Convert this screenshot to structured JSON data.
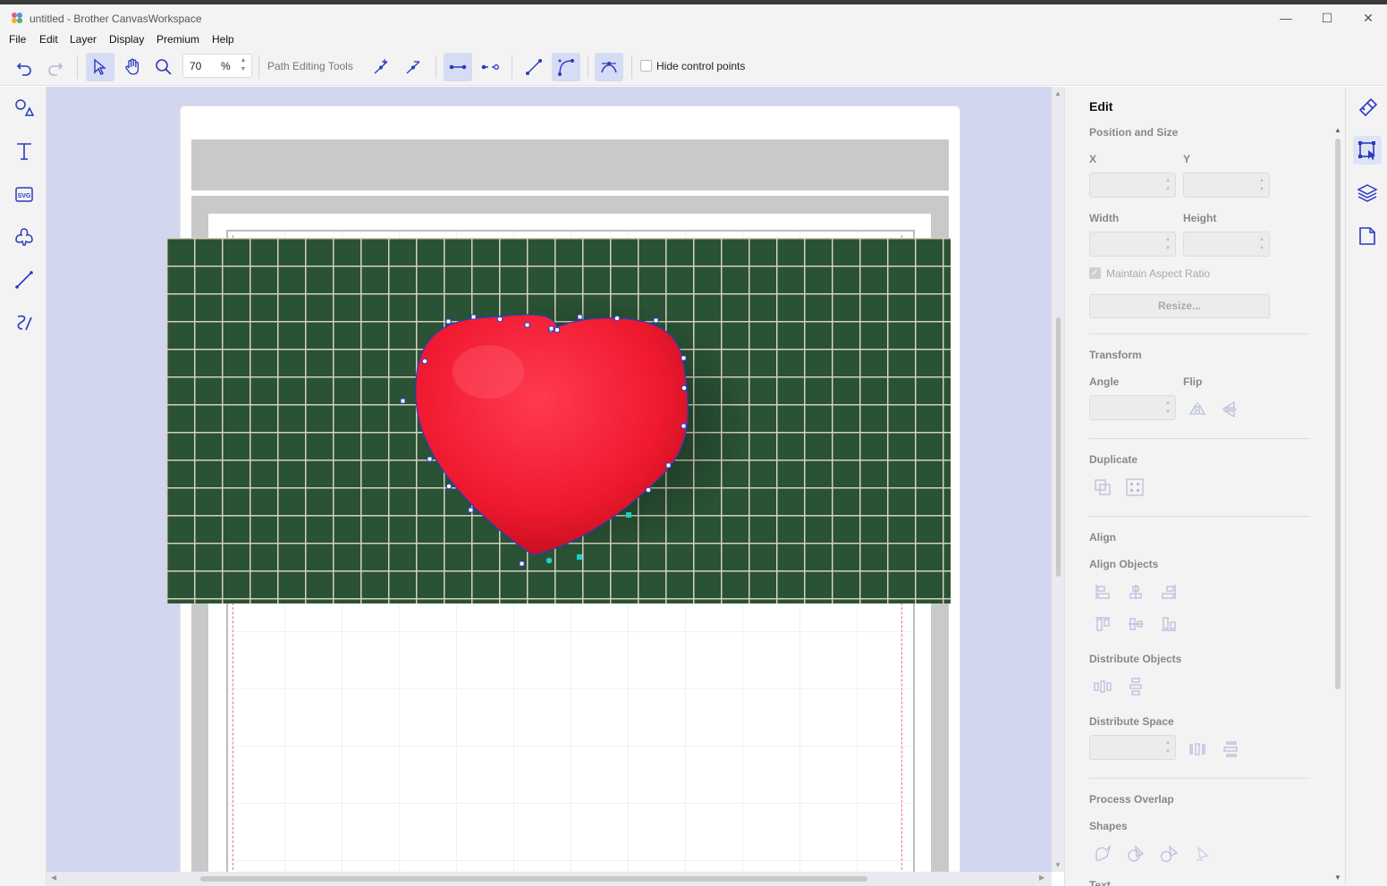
{
  "window": {
    "title": "untitled - Brother CanvasWorkspace",
    "minimize_glyph": "—",
    "maximize_glyph": "☐",
    "close_glyph": "✕"
  },
  "menu": {
    "items": [
      "File",
      "Edit",
      "Layer",
      "Display",
      "Premium",
      "Help"
    ]
  },
  "toolbar": {
    "zoom_value": "70",
    "zoom_unit": "%",
    "path_editing_label": "Path Editing Tools",
    "hide_control_points_label": "Hide control points",
    "hide_control_points_checked": false
  },
  "icons": {
    "toolbar": [
      "undo-icon",
      "redo-icon",
      "select-icon",
      "pan-hand-icon",
      "zoom-icon",
      "add-node-icon",
      "delete-node-icon",
      "join-nodes-icon",
      "break-node-icon",
      "straight-segment-icon",
      "curve-segment-icon",
      "smooth-node-icon"
    ],
    "left_tools": [
      "shapes-icon",
      "text-icon",
      "svg-icon",
      "pattern-icon",
      "line-icon",
      "freehand-icon"
    ],
    "right_tabs": [
      "paint-icon",
      "edit-transform-icon",
      "layers-icon",
      "page-icon"
    ]
  },
  "panel": {
    "title": "Edit",
    "position_size": "Position and Size",
    "x_label": "X",
    "y_label": "Y",
    "width_label": "Width",
    "height_label": "Height",
    "maintain_aspect": "Maintain Aspect Ratio",
    "resize_button": "Resize...",
    "transform": "Transform",
    "angle_label": "Angle",
    "flip_label": "Flip",
    "duplicate": "Duplicate",
    "align": "Align",
    "align_objects": "Align Objects",
    "distribute_objects": "Distribute Objects",
    "distribute_space": "Distribute Space",
    "process_overlap": "Process Overlap",
    "shapes": "Shapes",
    "text_partial": "Text"
  },
  "colors": {
    "accent": "#2b3bbf",
    "canvas_bg": "#d3d6ef",
    "heart": "#f5223a",
    "mat": "#2a5234",
    "selection_node": "#1ad0c8"
  }
}
